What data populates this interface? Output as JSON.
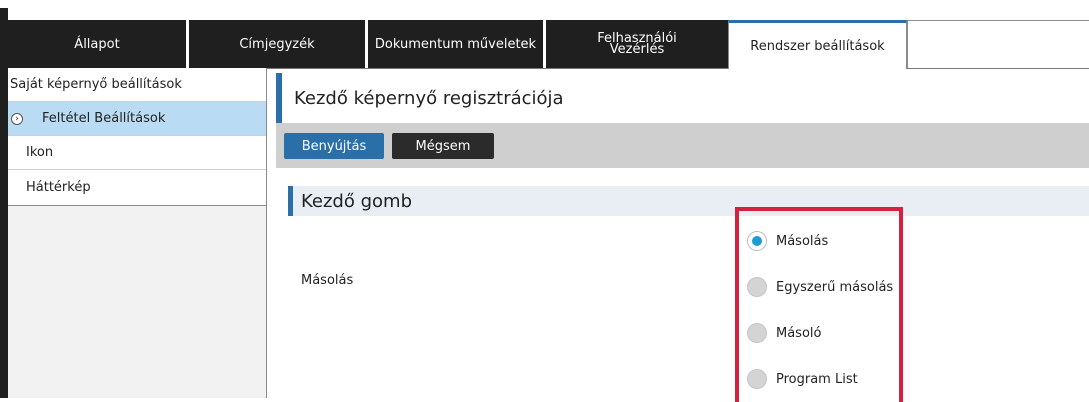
{
  "tabs": [
    {
      "label": "Állapot"
    },
    {
      "label": "Címjegyzék"
    },
    {
      "label": "Dokumentum műveletek"
    },
    {
      "label": "Felhasználói Vezérlés"
    },
    {
      "label": "Rendszer beállítások"
    }
  ],
  "sidebar": {
    "items": [
      {
        "label": "Saját képernyő beállítások"
      },
      {
        "label": "Feltétel Beállítások"
      },
      {
        "label": "Ikon"
      },
      {
        "label": "Háttérkép"
      }
    ]
  },
  "main": {
    "title": "Kezdő képernyő regisztrációja",
    "submit_label": "Benyújtás",
    "cancel_label": "Mégsem",
    "section_title": "Kezdő gomb",
    "row_label": "Másolás",
    "radio_options": [
      {
        "label": "Másolás",
        "selected": true
      },
      {
        "label": "Egyszerű másolás",
        "selected": false
      },
      {
        "label": "Másoló",
        "selected": false
      },
      {
        "label": "Program List",
        "selected": false
      }
    ]
  },
  "colors": {
    "accent": "#2a6fa8",
    "highlight_border": "#d4213d",
    "selected_row": "#b9dcf4",
    "radio_selected": "#1e9ad6"
  }
}
